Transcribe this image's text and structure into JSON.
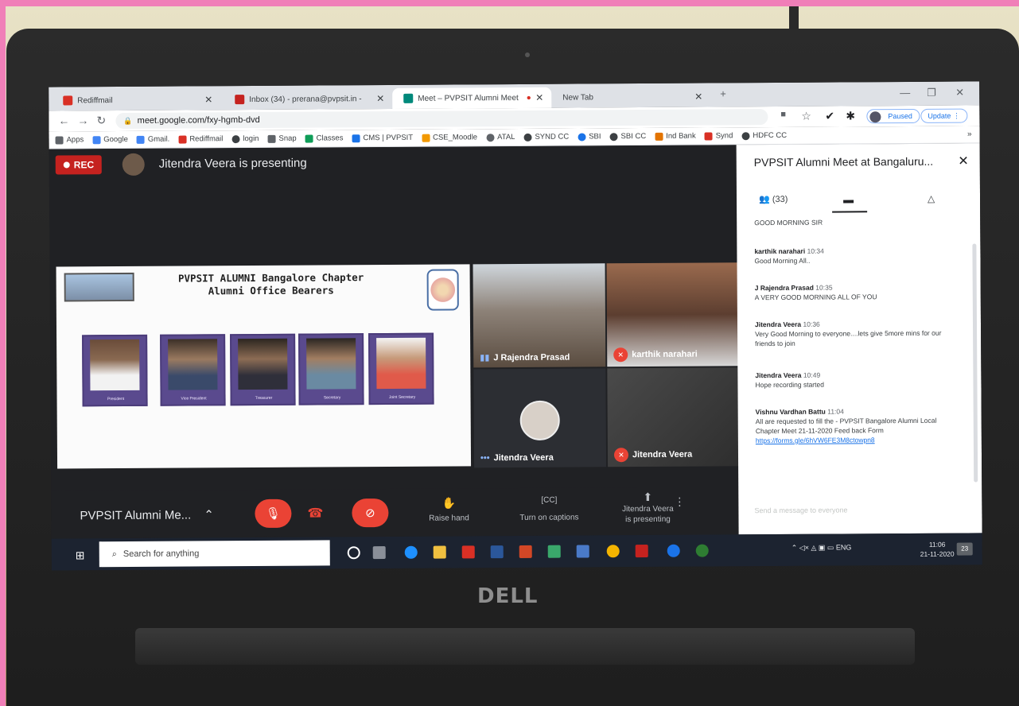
{
  "browser": {
    "tabs": [
      {
        "label": "Rediffmail",
        "color": "#d93025"
      },
      {
        "label": "Inbox (34) - prerana@pvpsit.in -",
        "color": "#c5221f"
      },
      {
        "label": "Meet – PVPSIT Alumni Meet",
        "color": "#00897b"
      },
      {
        "label": "New Tab",
        "color": "#dee1e6"
      }
    ],
    "url": "meet.google.com/fxy-hgmb-dvd",
    "profile_status": "Paused",
    "update_label": "Update",
    "bookmarks": [
      {
        "label": "Apps",
        "color": "#5f6368"
      },
      {
        "label": "Google",
        "color": "#4285f4"
      },
      {
        "label": "Gmail.",
        "color": "#4285f4"
      },
      {
        "label": "Rediffmail",
        "color": "#d93025"
      },
      {
        "label": "login",
        "color": "#3c4043"
      },
      {
        "label": "Snap",
        "color": "#5f6368"
      },
      {
        "label": "Classes",
        "color": "#0f9d58"
      },
      {
        "label": "CMS | PVPSIT",
        "color": "#1a73e8"
      },
      {
        "label": "CSE_Moodle",
        "color": "#f29900"
      },
      {
        "label": "ATAL",
        "color": "#5f6368"
      },
      {
        "label": "SYND CC",
        "color": "#3c4043"
      },
      {
        "label": "SBI",
        "color": "#1a73e8"
      },
      {
        "label": "SBI CC",
        "color": "#3c4043"
      },
      {
        "label": "Ind Bank",
        "color": "#e37400"
      },
      {
        "label": "Synd",
        "color": "#d93025"
      },
      {
        "label": "HDFC CC",
        "color": "#3c4043"
      }
    ]
  },
  "meet": {
    "rec_label": "REC",
    "presenting_text": "Jitendra Veera is presenting",
    "slide": {
      "title_line1": "PVPSIT ALUMNI Bangalore Chapter",
      "title_line2": "Alumni Office Bearers",
      "members": [
        {
          "role": "President"
        },
        {
          "role": "Vice President"
        },
        {
          "role": "Treasurer"
        },
        {
          "role": "Secretary"
        },
        {
          "role": "Joint Secretary"
        }
      ]
    },
    "tiles": [
      {
        "name": "J Rajendra Prasad",
        "muted": false
      },
      {
        "name": "karthik narahari",
        "muted": true
      },
      {
        "name": "Jitendra Veera",
        "muted": false
      },
      {
        "name": "Jitendra Veera",
        "muted": true
      }
    ],
    "meeting_title": "PVPSIT Alumni Me...",
    "controls": {
      "raise_hand": "Raise hand",
      "captions": "Turn on captions",
      "presenting_line1": "Jitendra Veera",
      "presenting_line2": "is presenting"
    }
  },
  "chat": {
    "title": "PVPSIT Alumni Meet at Bangaluru...",
    "participants": "(33)",
    "messages": [
      {
        "sender": "",
        "time": "",
        "text": "GOOD MORNING SIR"
      },
      {
        "sender": "karthik narahari",
        "time": "10:34",
        "text": "Good Morning All.."
      },
      {
        "sender": "J Rajendra Prasad",
        "time": "10:35",
        "text": "A VERY GOOD MORNING ALL OF YOU"
      },
      {
        "sender": "Jitendra Veera",
        "time": "10:36",
        "text": "Very Good Morning to everyone....lets give 5more mins for our friends to join"
      },
      {
        "sender": "Jitendra Veera",
        "time": "10:49",
        "text": "Hope recording started"
      },
      {
        "sender": "Vishnu Vardhan Battu",
        "time": "11:04",
        "text": "All are requested to fill the - PVPSIT Bangalore Alumni Local Chapter Meet 21-11-2020 Feed back Form",
        "link": "https://forms.gle/6hVW6FE3M8ctowpn8"
      }
    ],
    "send_placeholder": "Send a message to everyone"
  },
  "taskbar": {
    "search_placeholder": "Search for anything",
    "lang": "ENG",
    "time": "11:06",
    "date": "21-11-2020",
    "notif_count": "23"
  },
  "device": {
    "brand": "DELL"
  }
}
